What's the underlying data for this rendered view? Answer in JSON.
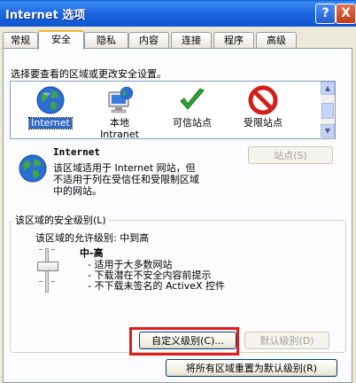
{
  "window": {
    "title": "Internet 选项",
    "help_label": "?",
    "close_label": "X"
  },
  "tabs": [
    {
      "label": "常规"
    },
    {
      "label": "安全"
    },
    {
      "label": "隐私"
    },
    {
      "label": "内容"
    },
    {
      "label": "连接"
    },
    {
      "label": "程序"
    },
    {
      "label": "高级"
    }
  ],
  "active_tab": "安全",
  "prompt": "选择要查看的区域或更改安全设置。",
  "zones": [
    {
      "label": "Internet",
      "icon": "globe-icon"
    },
    {
      "label": "本地",
      "label2": "Intranet",
      "icon": "computer-globe-icon"
    },
    {
      "label": "可信站点",
      "icon": "checkmark-icon"
    },
    {
      "label": "受限站点",
      "icon": "no-entry-icon"
    }
  ],
  "selected_zone": "Internet",
  "zone_info": {
    "name": "Internet",
    "desc_lines": [
      "该区域适用于 Internet 网站，但",
      "不适用于列在受信任和受限制区域",
      "中的网站。"
    ],
    "sites_button": "站点(S)"
  },
  "security_level": {
    "group_title": "该区域的安全级别(L)",
    "allowed_text": "该区域的允许级别: 中到高",
    "level_name": "中-高",
    "bullets": [
      "- 适用于大多数网站",
      "- 下载潜在不安全内容前提示",
      "- 不下载未签名的 ActiveX 控件"
    ]
  },
  "buttons": {
    "custom_level": "自定义级别(C)...",
    "default_level": "默认级别(D)",
    "reset_all": "将所有区域重置为默认级别(R)"
  },
  "colors": {
    "title_bar": "#1f6ae6",
    "selected_zone": "#316ac5",
    "highlight_box": "#e31b1b"
  }
}
